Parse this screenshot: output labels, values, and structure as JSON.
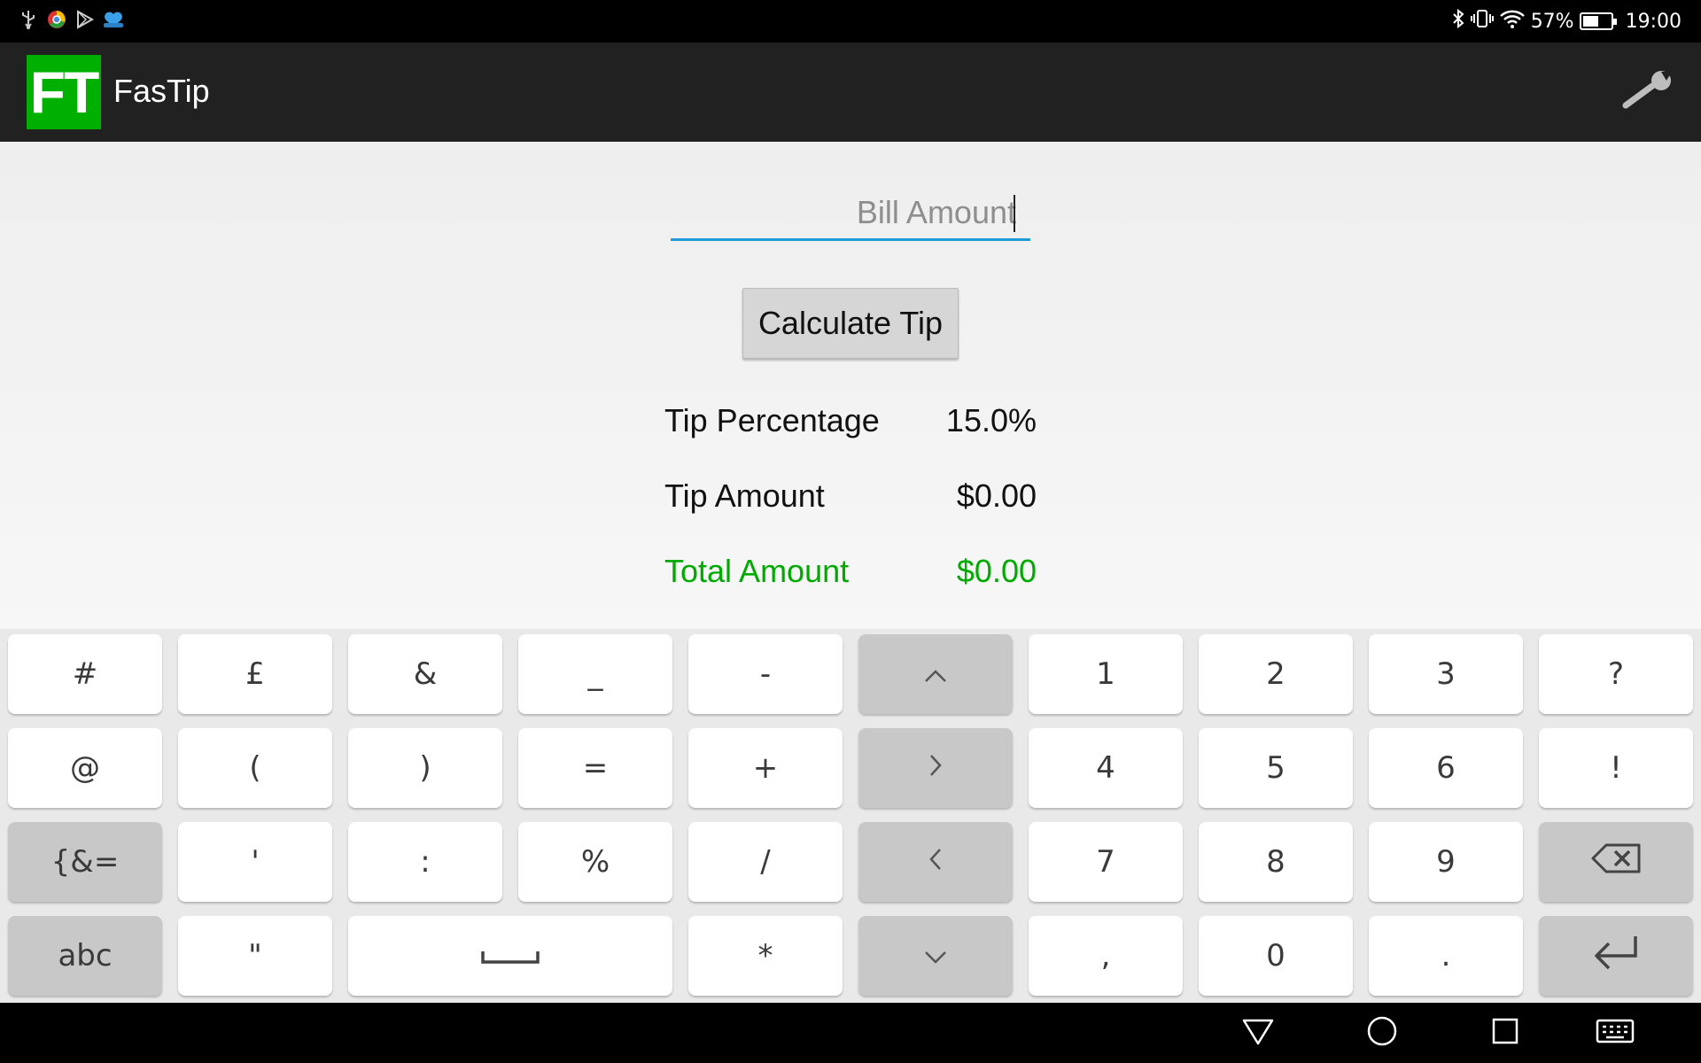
{
  "status_bar": {
    "battery_percent_text": "57%",
    "time": "19:00",
    "battery_level": 0.57,
    "notification_icons": [
      "usb-icon",
      "chrome-icon",
      "play-store-icon",
      "heart-app-icon"
    ]
  },
  "app_bar": {
    "logo_text": "FT",
    "title": "FasTip",
    "settings_icon": "wrench-icon"
  },
  "form": {
    "bill_amount_placeholder": "Bill Amount",
    "bill_amount_value": "",
    "calculate_label": "Calculate Tip",
    "tip_percentage_label": "Tip Percentage",
    "tip_percentage_value": "15.0%",
    "tip_amount_label": "Tip Amount",
    "tip_amount_value": "$0.00",
    "total_amount_label": "Total Amount",
    "total_amount_value": "$0.00"
  },
  "keyboard": {
    "rows": [
      [
        "#",
        "£",
        "&",
        "_",
        "-",
        "^",
        "1",
        "2",
        "3",
        "?"
      ],
      [
        "@",
        "(",
        ")",
        "=",
        "+",
        ">",
        "4",
        "5",
        "6",
        "!"
      ],
      [
        "{&=",
        "'",
        ":",
        "%",
        "/",
        "<",
        "7",
        "8",
        "9",
        "⌫"
      ],
      [
        "abc",
        "\"",
        "␣",
        "*",
        "v",
        ",",
        "0",
        ".",
        "⏎"
      ]
    ]
  },
  "colors": {
    "accent_green": "#00b000",
    "total_green": "#00aa00",
    "input_underline": "#1e9bd7",
    "app_bar": "#212121"
  }
}
